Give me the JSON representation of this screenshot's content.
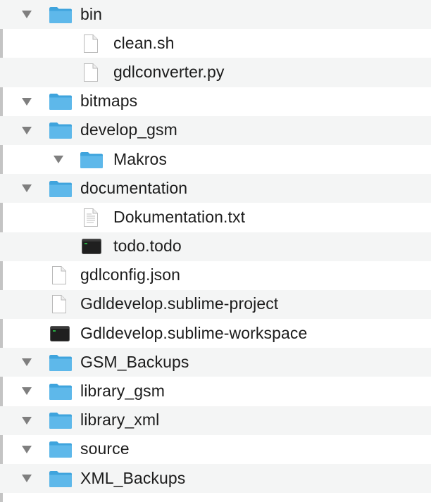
{
  "rows": [
    {
      "label": "bin",
      "icon": "folder-icon",
      "level": 0,
      "disclosure": true
    },
    {
      "label": "clean.sh",
      "icon": "file-icon",
      "level": 1,
      "disclosure": false
    },
    {
      "label": "gdlconverter.py",
      "icon": "file-icon",
      "level": 1,
      "disclosure": false
    },
    {
      "label": "bitmaps",
      "icon": "folder-icon",
      "level": 0,
      "disclosure": true
    },
    {
      "label": "develop_gsm",
      "icon": "folder-icon",
      "level": 0,
      "disclosure": true
    },
    {
      "label": "Makros",
      "icon": "folder-icon",
      "level": 1,
      "disclosure": true
    },
    {
      "label": "documentation",
      "icon": "folder-icon",
      "level": 0,
      "disclosure": true
    },
    {
      "label": "Dokumentation.txt",
      "icon": "text-file-icon",
      "level": 1,
      "disclosure": false
    },
    {
      "label": "todo.todo",
      "icon": "terminal-file-icon",
      "level": 1,
      "disclosure": false
    },
    {
      "label": "gdlconfig.json",
      "icon": "file-icon",
      "level": 0,
      "disclosure": false
    },
    {
      "label": "Gdldevelop.sublime-project",
      "icon": "file-icon",
      "level": 0,
      "disclosure": false
    },
    {
      "label": "Gdldevelop.sublime-workspace",
      "icon": "terminal-file-icon",
      "level": 0,
      "disclosure": false
    },
    {
      "label": "GSM_Backups",
      "icon": "folder-icon",
      "level": 0,
      "disclosure": true
    },
    {
      "label": "library_gsm",
      "icon": "folder-icon",
      "level": 0,
      "disclosure": true
    },
    {
      "label": "library_xml",
      "icon": "folder-icon",
      "level": 0,
      "disclosure": true
    },
    {
      "label": "source",
      "icon": "folder-icon",
      "level": 0,
      "disclosure": true
    },
    {
      "label": "XML_Backups",
      "icon": "folder-icon",
      "level": 0,
      "disclosure": true
    }
  ],
  "colors": {
    "folder": "#5eb8ea",
    "folder_tab": "#3fa4dd",
    "stripe": "#f4f5f5",
    "disclosure": "#7f7f7f",
    "text": "#1c1c1c"
  }
}
